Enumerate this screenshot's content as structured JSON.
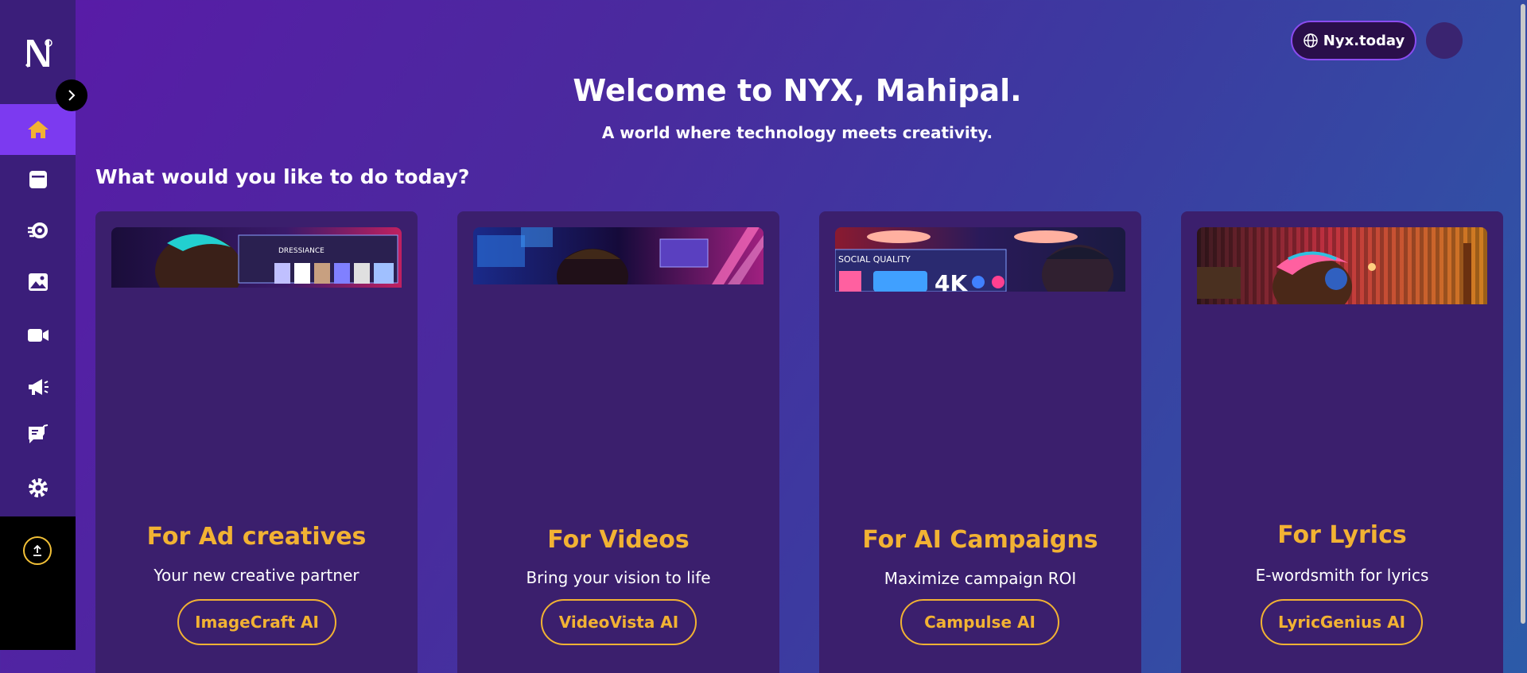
{
  "header": {
    "site_button_label": "Nyx.today",
    "title": "Welcome to NYX, Mahipal.",
    "subtitle": "A world where technology meets creativity."
  },
  "sidebar": {
    "items": [
      {
        "icon": "home-icon",
        "active": true
      },
      {
        "icon": "stack-icon",
        "active": false
      },
      {
        "icon": "campaign-gear-icon",
        "active": false
      },
      {
        "icon": "image-icon",
        "active": false
      },
      {
        "icon": "video-icon",
        "active": false
      },
      {
        "icon": "megaphone-icon",
        "active": false
      },
      {
        "icon": "lyrics-icon",
        "active": false
      },
      {
        "icon": "gear-icon",
        "active": false
      }
    ],
    "upload_icon": "upload-icon"
  },
  "main": {
    "question": "What would you like to do today?",
    "cards": [
      {
        "heading": "For Ad creatives",
        "tagline": "Your new creative partner",
        "cta": "ImageCraft AI",
        "thumb_text": "DRESSIANCE"
      },
      {
        "heading": "For Videos",
        "tagline": "Bring your vision to life",
        "cta": "VideoVista AI"
      },
      {
        "heading": "For AI Campaigns",
        "tagline": "Maximize campaign ROI",
        "cta": "Campulse AI",
        "thumb_text": "SOCIAL QUALITY",
        "thumb_badge": "4K"
      },
      {
        "heading": "For Lyrics",
        "tagline": "E-wordsmith for lyrics",
        "cta": "LyricGenius AI"
      }
    ]
  },
  "colors": {
    "accent": "#f2b233",
    "active_nav": "#7c3af0",
    "card_bg": "#3b1f6d",
    "sidebar_bg": "#3b1e7a"
  }
}
